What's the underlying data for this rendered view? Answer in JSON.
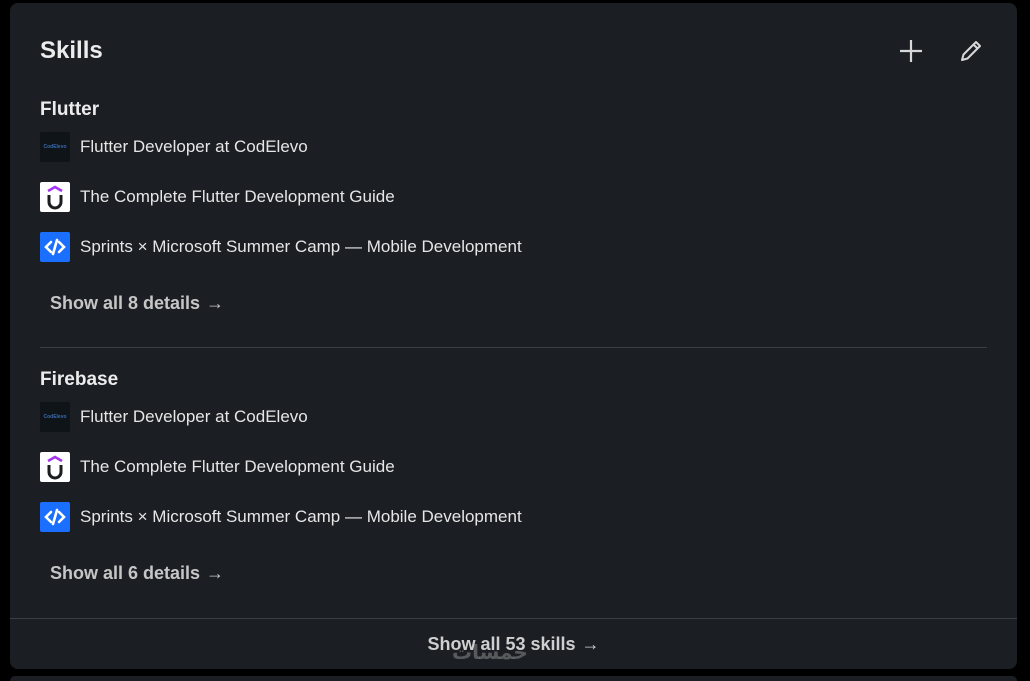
{
  "section": {
    "title": "Skills",
    "add_icon": "plus-icon",
    "edit_icon": "pencil-icon"
  },
  "skills": [
    {
      "name": "Flutter",
      "items": [
        {
          "text": "Flutter Developer at CodElevo",
          "logo": "codelevo-logo",
          "logo_text": "CodElevo"
        },
        {
          "text": "The Complete Flutter Development Guide",
          "logo": "udemy-logo"
        },
        {
          "text": "Sprints × Microsoft Summer Camp — Mobile Development",
          "logo": "sprints-logo"
        }
      ],
      "show_details": "Show all 8 details"
    },
    {
      "name": "Firebase",
      "items": [
        {
          "text": "Flutter Developer at CodElevo",
          "logo": "codelevo-logo",
          "logo_text": "CodElevo"
        },
        {
          "text": "The Complete Flutter Development Guide",
          "logo": "udemy-logo"
        },
        {
          "text": "Sprints × Microsoft Summer Camp — Mobile Development",
          "logo": "sprints-logo"
        }
      ],
      "show_details": "Show all 6 details"
    }
  ],
  "footer": {
    "label": "Show all 53 skills"
  },
  "watermark": "خمسات",
  "colors": {
    "card_bg": "#1b1f23",
    "page_bg": "#000000",
    "udemy_purple": "#a435f0",
    "sprints_blue": "#1a6fff"
  }
}
